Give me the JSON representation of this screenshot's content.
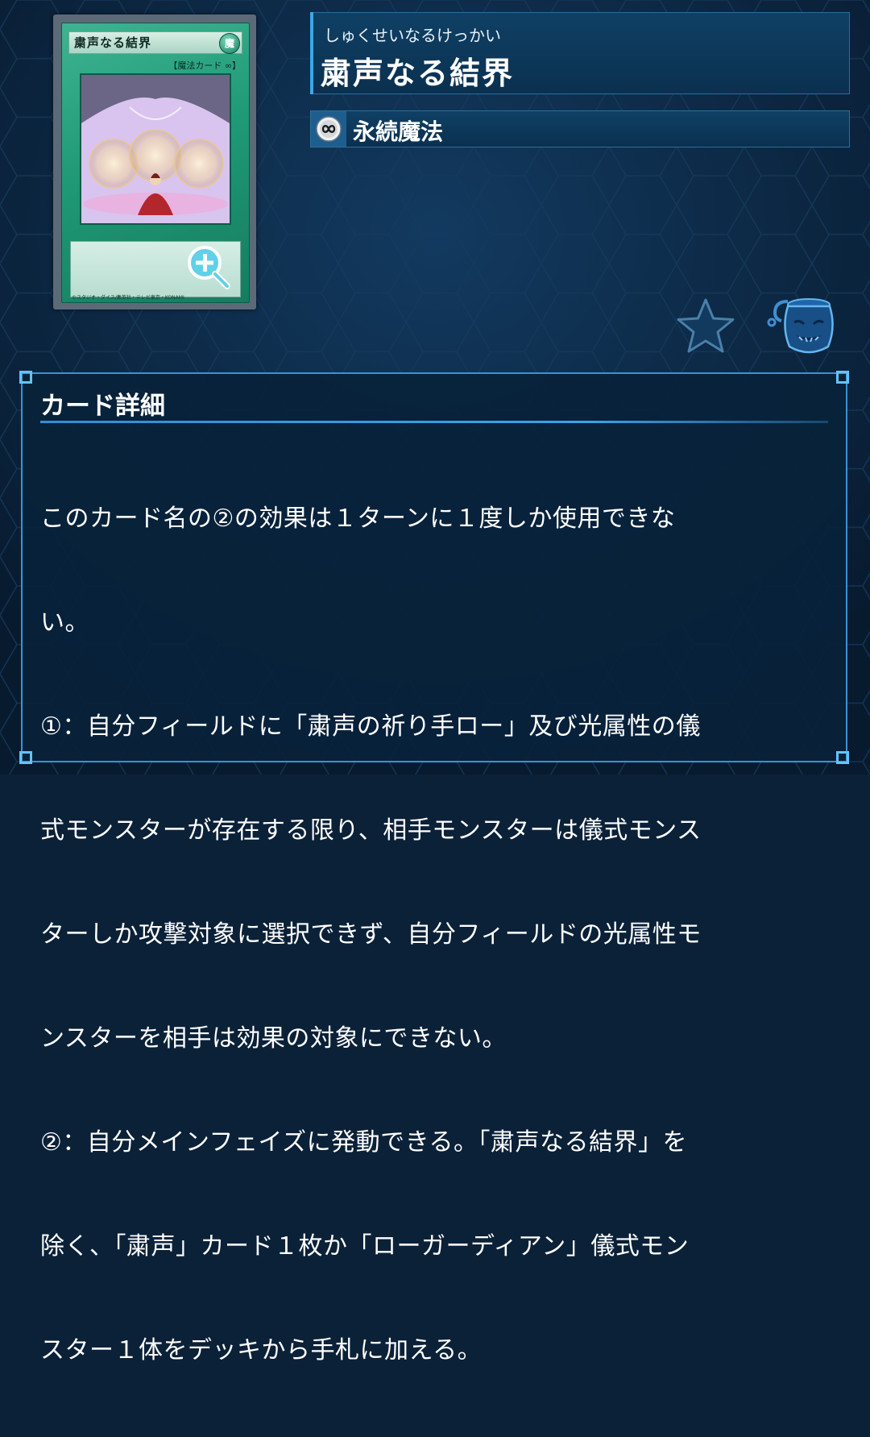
{
  "card": {
    "image_name": "粛声なる結界",
    "image_attribute": "魔",
    "image_type_line": "【魔法カード ∞】",
    "image_footer": "©スタジオ・ダイス/集英社・テレビ東京・KONAMI"
  },
  "title": {
    "reading": "しゅくせいなるけっかい",
    "name": "粛声なる結界"
  },
  "type": {
    "icon": "continuous-infinity-icon",
    "label": "永続魔法"
  },
  "actions": {
    "favorite_icon": "star-icon",
    "deck_icon": "deck-pot-icon"
  },
  "detail": {
    "heading": "カード詳細",
    "lines": [
      "このカード名の②の効果は１ターンに１度しか使用できな",
      "い。",
      "①：自分フィールドに「粛声の祈り手ロー」及び光属性の儀",
      "式モンスターが存在する限り、相手モンスターは儀式モンス",
      "ターしか攻撃対象に選択できず、自分フィールドの光属性モ",
      "ンスターを相手は効果の対象にできない。",
      "②：自分メインフェイズに発動できる。「粛声なる結界」を",
      "除く、「粛声」カード１枚か「ローガーディアン」儀式モン",
      "スター１体をデッキから手札に加える。"
    ]
  },
  "colors": {
    "background": "#0b2138",
    "panel": "#0f4064",
    "accent": "#3aa8e6",
    "card_green": "#1f9a77"
  }
}
